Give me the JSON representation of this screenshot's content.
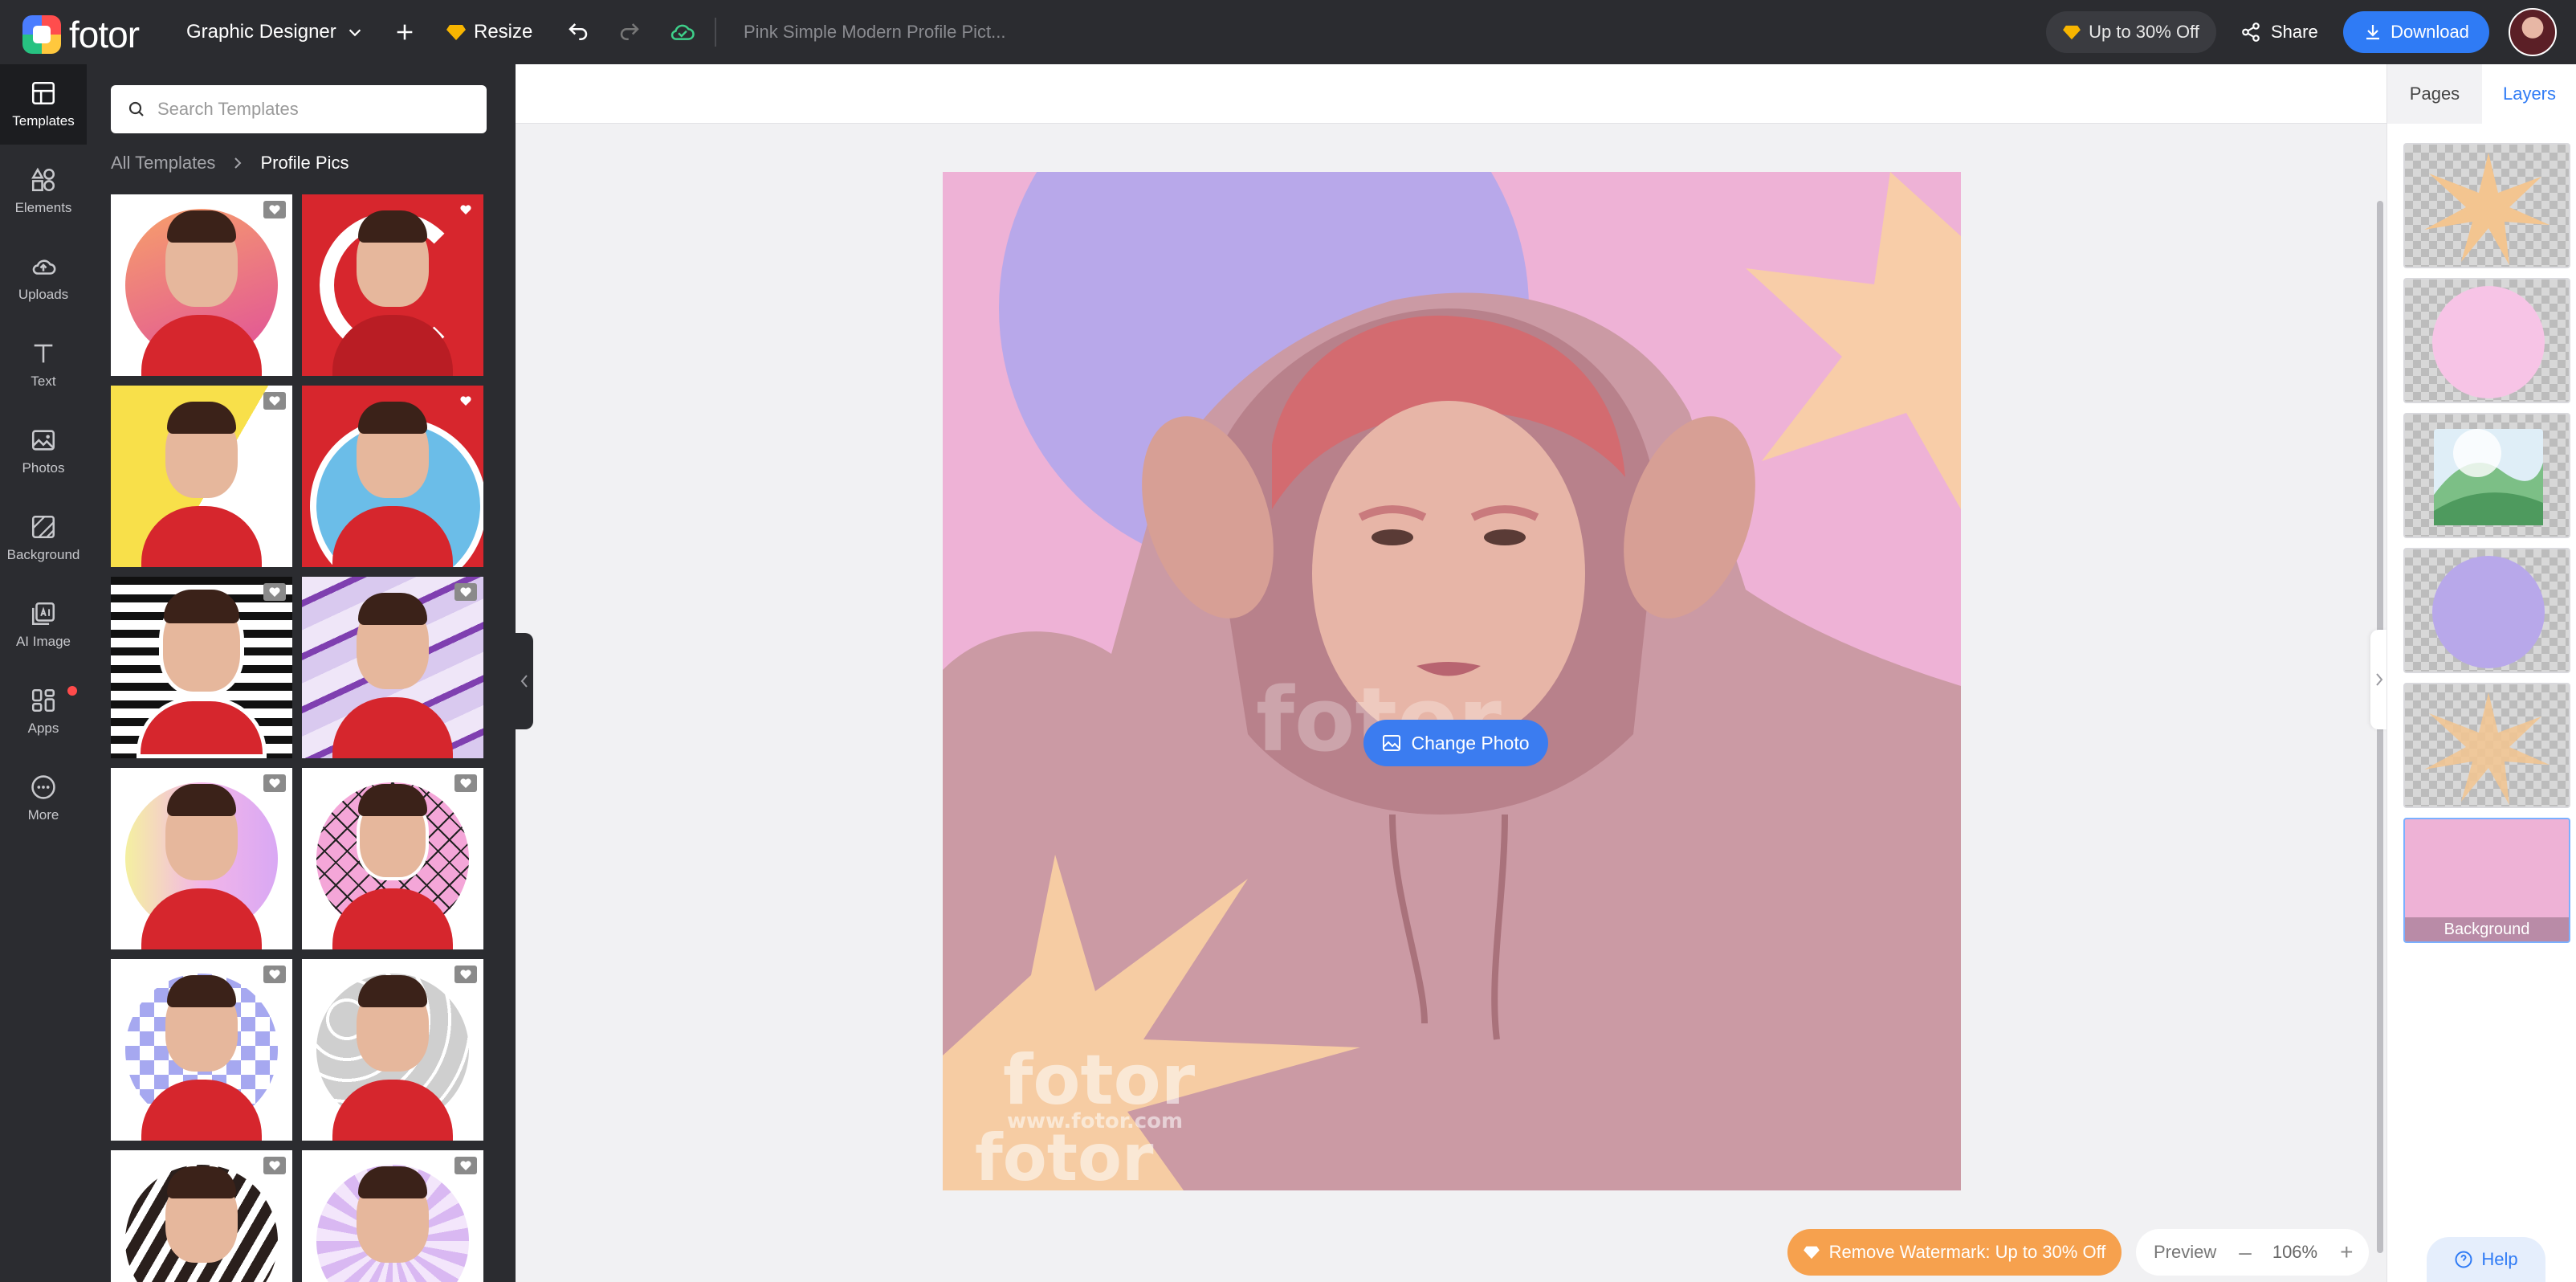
{
  "app": {
    "logo_text": "fotor"
  },
  "topbar": {
    "role_label": "Graphic Designer",
    "resize_label": "Resize",
    "doc_title": "Pink Simple Modern Profile Pict...",
    "promo_label": "Up to 30% Off",
    "share_label": "Share",
    "download_label": "Download"
  },
  "rail": {
    "items": [
      {
        "label": "Templates",
        "icon": "templates-icon"
      },
      {
        "label": "Elements",
        "icon": "elements-icon"
      },
      {
        "label": "Uploads",
        "icon": "uploads-icon"
      },
      {
        "label": "Text",
        "icon": "text-icon"
      },
      {
        "label": "Photos",
        "icon": "photos-icon"
      },
      {
        "label": "Background",
        "icon": "background-icon"
      },
      {
        "label": "AI Image",
        "icon": "ai-image-icon"
      },
      {
        "label": "Apps",
        "icon": "apps-icon"
      },
      {
        "label": "More",
        "icon": "more-icon"
      }
    ]
  },
  "panel": {
    "search_placeholder": "Search Templates",
    "breadcrumb_parent": "All Templates",
    "breadcrumb_current": "Profile Pics"
  },
  "canvas": {
    "change_photo_label": "Change Photo"
  },
  "bottom": {
    "watermark_label": "Remove Watermark: Up to 30% Off",
    "preview_label": "Preview",
    "zoom_minus": "–",
    "zoom_level": "106%",
    "zoom_plus": "+"
  },
  "right_panel": {
    "tab_pages": "Pages",
    "tab_layers": "Layers",
    "background_layer_label": "Background"
  },
  "help_label": "Help",
  "colors": {
    "dark_bg": "#2b2c30",
    "accent_blue": "#2f7bf5",
    "artboard_pink": "#eeb2d6",
    "lavender": "#b8a8ea",
    "peach": "#f8cfa3",
    "orange": "#f6a14e"
  }
}
